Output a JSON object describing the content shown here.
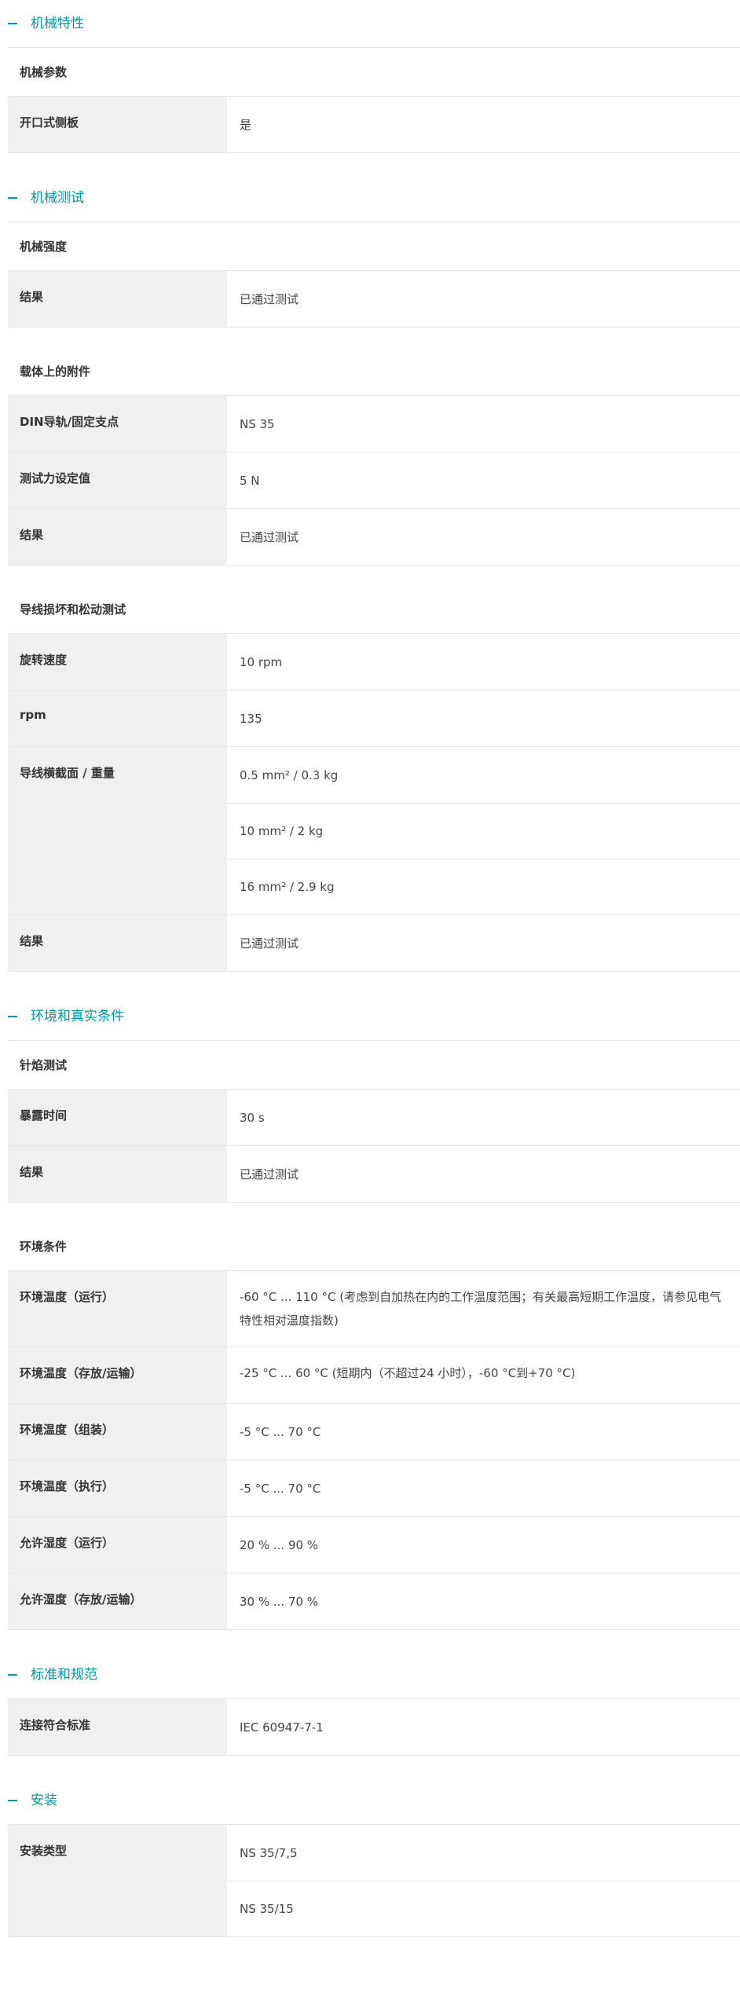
{
  "sections": [
    {
      "title": "机械特性",
      "groups": [
        {
          "title": "机械参数",
          "rows": [
            {
              "label": "开口式侧板",
              "values": [
                "是"
              ]
            }
          ]
        }
      ]
    },
    {
      "title": "机械测试",
      "groups": [
        {
          "title": "机械强度",
          "rows": [
            {
              "label": "结果",
              "values": [
                "已通过测试"
              ]
            }
          ]
        },
        {
          "title": "载体上的附件",
          "rows": [
            {
              "label": "DIN导轨/固定支点",
              "values": [
                "NS 35"
              ]
            },
            {
              "label": "测试力设定值",
              "values": [
                "5 N"
              ]
            },
            {
              "label": "结果",
              "values": [
                "已通过测试"
              ]
            }
          ]
        },
        {
          "title": "导线损坏和松动测试",
          "rows": [
            {
              "label": "旋转速度",
              "values": [
                "10 rpm"
              ]
            },
            {
              "label": "rpm",
              "values": [
                "135"
              ]
            },
            {
              "label": "导线横截面 / 重量",
              "values": [
                "0.5 mm² / 0.3 kg",
                "10 mm² / 2 kg",
                "16 mm² / 2.9 kg"
              ]
            },
            {
              "label": "结果",
              "values": [
                "已通过测试"
              ]
            }
          ]
        }
      ]
    },
    {
      "title": "环境和真实条件",
      "groups": [
        {
          "title": "针焰测试",
          "rows": [
            {
              "label": "暴露时间",
              "values": [
                "30 s"
              ]
            },
            {
              "label": "结果",
              "values": [
                "已通过测试"
              ]
            }
          ]
        },
        {
          "title": "环境条件",
          "rows": [
            {
              "label": "环境温度（运行）",
              "values": [
                "-60 °C ... 110 °C (考虑到自加热在内的工作温度范围；有关最高短期工作温度，请参见电气特性相对温度指数)"
              ]
            },
            {
              "label": "环境温度（存放/运输）",
              "values": [
                "-25 °C ... 60 °C (短期内（不超过24 小时），-60 °C到+70 °C)"
              ]
            },
            {
              "label": "环境温度（组装）",
              "values": [
                "-5 °C ... 70 °C"
              ]
            },
            {
              "label": "环境温度（执行）",
              "values": [
                "-5 °C ... 70 °C"
              ]
            },
            {
              "label": "允许湿度（运行）",
              "values": [
                "20 % ... 90 %"
              ]
            },
            {
              "label": "允许湿度（存放/运输）",
              "values": [
                "30 % ... 70 %"
              ]
            }
          ]
        }
      ]
    },
    {
      "title": "标准和规范",
      "groups": [
        {
          "title": "",
          "rows": [
            {
              "label": "连接符合标准",
              "values": [
                "IEC 60947-7-1"
              ]
            }
          ]
        }
      ]
    },
    {
      "title": "安装",
      "groups": [
        {
          "title": "",
          "rows": [
            {
              "label": "安装类型",
              "values": [
                "NS 35/7,5",
                "NS 35/15"
              ]
            }
          ]
        }
      ]
    }
  ],
  "colors": {
    "accent": "#0098a1",
    "label_bg": "#f0f0f0",
    "divider": "#e6e6e6"
  },
  "icons": {
    "section_toggle": "minus-icon"
  }
}
